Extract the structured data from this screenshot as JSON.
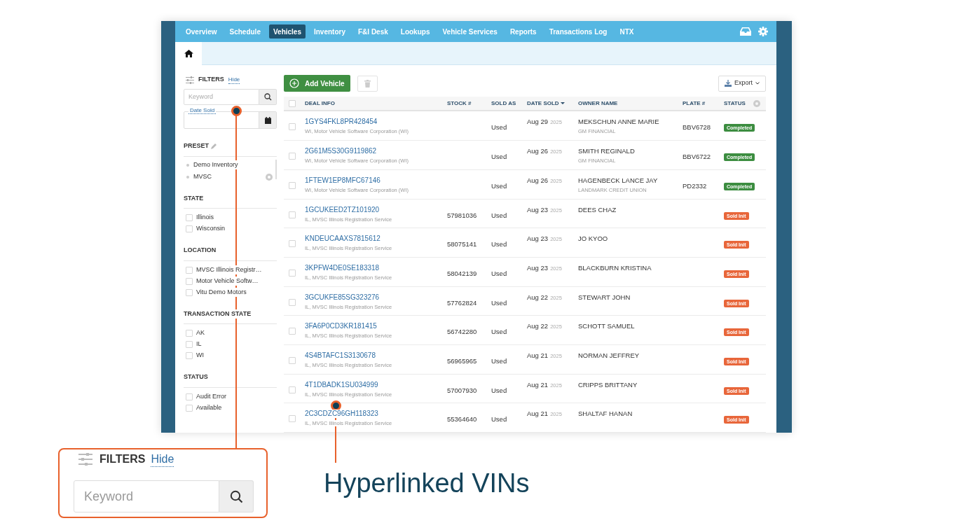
{
  "nav": {
    "items": [
      {
        "label": "Overview",
        "selected": false
      },
      {
        "label": "Schedule",
        "selected": false
      },
      {
        "label": "Vehicles",
        "selected": true
      },
      {
        "label": "Inventory",
        "selected": false
      },
      {
        "label": "F&I Desk",
        "selected": false
      },
      {
        "label": "Lookups",
        "selected": false
      },
      {
        "label": "Vehicle Services",
        "selected": false
      },
      {
        "label": "Reports",
        "selected": false
      },
      {
        "label": "Transactions Log",
        "selected": false
      },
      {
        "label": "NTX",
        "selected": false
      }
    ]
  },
  "filters": {
    "title": "FILTERS",
    "hide_link": "Hide",
    "keyword": {
      "placeholder": "Keyword"
    },
    "date_sold": {
      "label": "Date Sold"
    },
    "preset": {
      "title": "PRESET",
      "items": [
        {
          "label": "Demo Inventory",
          "kind": "plain"
        },
        {
          "label": "MVSC",
          "kind": "viewable"
        }
      ]
    },
    "groups": [
      {
        "title": "STATE",
        "items": [
          {
            "label": "Illinois",
            "checked": false
          },
          {
            "label": "Wisconsin",
            "checked": false
          }
        ]
      },
      {
        "title": "LOCATION",
        "items": [
          {
            "label": "MVSC Illinois Registr…",
            "checked": false
          },
          {
            "label": "Motor Vehicle Softw…",
            "checked": false
          },
          {
            "label": "Vitu Demo Motors",
            "checked": false
          }
        ]
      },
      {
        "title": "TRANSACTION STATE",
        "items": [
          {
            "label": "AK",
            "checked": false
          },
          {
            "label": "IL",
            "checked": false
          },
          {
            "label": "WI",
            "checked": false
          }
        ]
      },
      {
        "title": "STATUS",
        "items": [
          {
            "label": "Audit Error",
            "checked": false
          },
          {
            "label": "Available",
            "checked": false
          }
        ]
      }
    ]
  },
  "toolbar": {
    "add_button": "Add Vehicle",
    "export_button": "Export"
  },
  "table": {
    "select_all": {
      "checked": false
    },
    "columns": [
      {
        "label": "DEAL INFO",
        "sorted": false
      },
      {
        "label": "STOCK #",
        "sorted": false
      },
      {
        "label": "SOLD AS",
        "sorted": false
      },
      {
        "label": "DATE SOLD",
        "sorted": true
      },
      {
        "label": "OWNER NAME",
        "sorted": false
      },
      {
        "label": "PLATE #",
        "sorted": false
      },
      {
        "label": "STATUS",
        "sorted": false
      }
    ],
    "rows": [
      {
        "checked": false,
        "vin": "1GYS4FKL8PR428454",
        "location": "WI, Motor Vehicle Software Corporation (WI)",
        "stock": "",
        "sold_as": "Used",
        "date": "Aug 29",
        "year": "2025",
        "owner": "MEKSCHUN ANNE MARIE",
        "lender": "GM FINANCIAL",
        "plate": "BBV6728",
        "status": {
          "label": "Completed",
          "color": "#3c8d40"
        }
      },
      {
        "checked": false,
        "vin": "2G61M5S30G9119862",
        "location": "WI, Motor Vehicle Software Corporation (WI)",
        "stock": "",
        "sold_as": "Used",
        "date": "Aug 26",
        "year": "2025",
        "owner": "SMITH REGINALD",
        "lender": "GM FINANCIAL",
        "plate": "BBV6722",
        "status": {
          "label": "Completed",
          "color": "#3c8d40"
        }
      },
      {
        "checked": false,
        "vin": "1FTEW1EP8MFC67146",
        "location": "WI, Motor Vehicle Software Corporation (WI)",
        "stock": "",
        "sold_as": "Used",
        "date": "Aug 26",
        "year": "2025",
        "owner": "HAGENBECK LANCE JAY",
        "lender": "LANDMARK CREDIT UNION",
        "plate": "PD2332",
        "status": {
          "label": "Completed",
          "color": "#3c8d40"
        }
      },
      {
        "checked": false,
        "vin": "1GCUKEED2TZ101920",
        "location": "IL, MVSC Illinois Registration Service",
        "stock": "57981036",
        "sold_as": "Used",
        "date": "Aug 23",
        "year": "2025",
        "owner": "DEES CHAZ",
        "lender": "",
        "plate": "",
        "status": {
          "label": "Sold Init",
          "color": "#e8663a"
        }
      },
      {
        "checked": false,
        "vin": "KNDEUCAAXS7815612",
        "location": "IL, MVSC Illinois Registration Service",
        "stock": "58075141",
        "sold_as": "Used",
        "date": "Aug 23",
        "year": "2025",
        "owner": "JO KYOO",
        "lender": "",
        "plate": "",
        "status": {
          "label": "Sold Init",
          "color": "#e8663a"
        }
      },
      {
        "checked": false,
        "vin": "3KPFW4DE0SE183318",
        "location": "IL, MVSC Illinois Registration Service",
        "stock": "58042139",
        "sold_as": "Used",
        "date": "Aug 23",
        "year": "2025",
        "owner": "BLACKBURN KRISTINA",
        "lender": "",
        "plate": "",
        "status": {
          "label": "Sold Init",
          "color": "#e8663a"
        }
      },
      {
        "checked": false,
        "vin": "3GCUKFE85SG323276",
        "location": "IL, MVSC Illinois Registration Service",
        "stock": "57762824",
        "sold_as": "Used",
        "date": "Aug 22",
        "year": "2025",
        "owner": "STEWART JOHN",
        "lender": "",
        "plate": "",
        "status": {
          "label": "Sold Init",
          "color": "#e8663a"
        }
      },
      {
        "checked": false,
        "vin": "3FA6P0CD3KR181415",
        "location": "IL, MVSC Illinois Registration Service",
        "stock": "56742280",
        "sold_as": "Used",
        "date": "Aug 22",
        "year": "2025",
        "owner": "SCHOTT SAMUEL",
        "lender": "",
        "plate": "",
        "status": {
          "label": "Sold Init",
          "color": "#e8663a"
        }
      },
      {
        "checked": false,
        "vin": "4S4BTAFC1S3130678",
        "location": "IL, MVSC Illinois Registration Service",
        "stock": "56965965",
        "sold_as": "Used",
        "date": "Aug 21",
        "year": "2025",
        "owner": "NORMAN JEFFREY",
        "lender": "",
        "plate": "",
        "status": {
          "label": "Sold Init",
          "color": "#e8663a"
        }
      },
      {
        "checked": false,
        "vin": "4T1DBADK1SU034999",
        "location": "IL, MVSC Illinois Registration Service",
        "stock": "57007930",
        "sold_as": "Used",
        "date": "Aug 21",
        "year": "2025",
        "owner": "CRIPPS BRITTANY",
        "lender": "",
        "plate": "",
        "status": {
          "label": "Sold Init",
          "color": "#e8663a"
        }
      },
      {
        "checked": false,
        "vin": "2C3CDZC96GH118323",
        "location": "IL, MVSC Illinois Registration Service",
        "stock": "55364640",
        "sold_as": "Used",
        "date": "Aug 21",
        "year": "2025",
        "owner": "SHALTAF HANAN",
        "lender": "",
        "plate": "",
        "status": {
          "label": "Sold Init",
          "color": "#e8663a"
        }
      }
    ]
  },
  "callouts": {
    "inset": {
      "title": "FILTERS",
      "hide_link": "Hide",
      "placeholder": "Keyword"
    },
    "caption": "Hyperlinked VINs"
  }
}
